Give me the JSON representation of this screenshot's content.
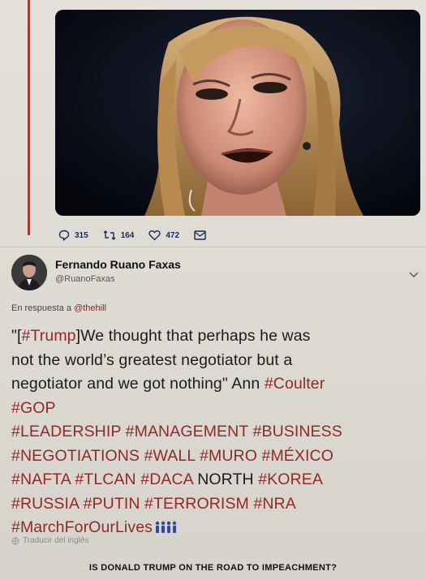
{
  "tweet_actions": {
    "replies": "315",
    "retweets": "164",
    "likes": "472"
  },
  "author": {
    "name": "Fernando Ruano Faxas",
    "handle": "@RuanoFaxas"
  },
  "reply_to": {
    "prefix": "En respuesta a",
    "mention": "@thehill"
  },
  "tweet": {
    "line1_pre": "\"[",
    "line1_tag": "#Trump",
    "line1_post": "]We thought that perhaps he was",
    "line2": "not the world’s greatest negotiator but a",
    "line3_pre": "negotiator and we got nothing\" Ann ",
    "line3_tag": "#Coulter",
    "tags_line4": "#GOP",
    "tags_line5": "#LEADERSHIP #MANAGEMENT #BUSINESS",
    "tags_line6": "#NEGOTIATIONS #WALL #MURO #MÉXICO",
    "tags_line7a": "#NAFTA #TLCAN #DACA",
    "line7_word": " NORTH ",
    "tags_line7b": "#KOREA",
    "tags_line8": "#RUSSIA #PUTIN #TERRORISM #NRA",
    "tags_line9": "#MarchForOurLives"
  },
  "translate_label": "Traducir del inglés",
  "headline": "IS DONALD TRUMP ON THE ROAD TO IMPEACHMENT?",
  "colors": {
    "hashtag": "#8f2a26",
    "thread_line": "#a33b2e",
    "icon_blue": "#1a2a55"
  },
  "icons": [
    "reply-icon",
    "retweet-icon",
    "like-icon",
    "dm-icon",
    "chevron-down-icon",
    "globe-icon",
    "people-icon"
  ]
}
